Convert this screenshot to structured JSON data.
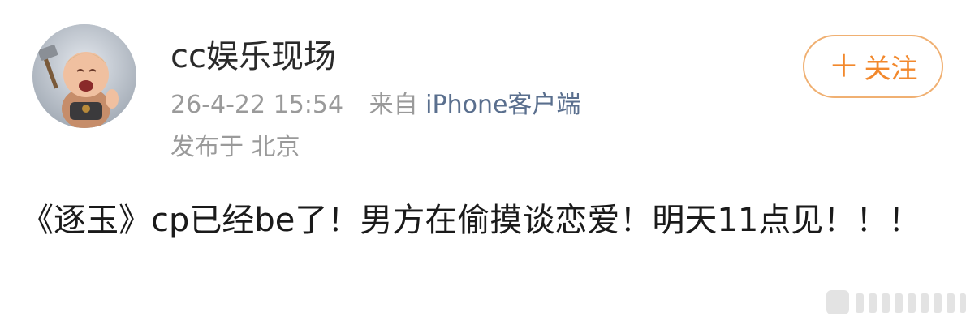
{
  "post": {
    "username": "cc娱乐现场",
    "time": "26-4-22 15:54",
    "source_prefix": "来自",
    "source_device": "iPhone客户端",
    "location": "发布于 北京",
    "follow_label": "关注",
    "follow_icon": "plus-icon",
    "text": "《逐玉》cp已经be了！男方在偷摸谈恋爱！明天11点见！！！"
  },
  "colors": {
    "follow_accent": "#f2882c",
    "follow_border": "#f0b072",
    "source_link": "#5a6f8e",
    "meta_gray": "#9a9a9a"
  }
}
